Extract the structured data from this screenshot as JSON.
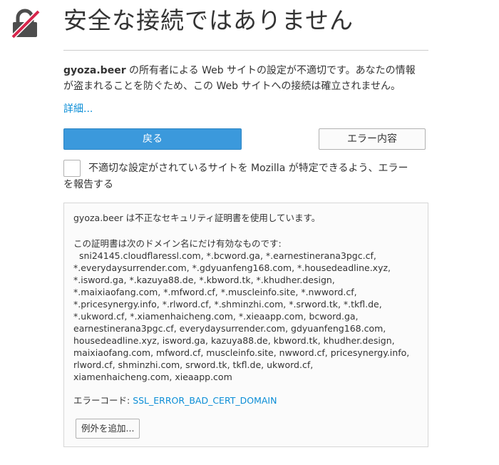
{
  "icon": {
    "name": "broken-lock-icon",
    "lock_color": "#4d4d4d",
    "strike_color": "#d7264c"
  },
  "header": {
    "title": "安全な接続ではありません"
  },
  "description": {
    "domain": "gyoza.beer",
    "line1_rest": " の所有者による Web サイトの設定が不適切です。あなたの情報",
    "line2": "が盗まれることを防ぐため、この Web サイトへの接続は確立されません。"
  },
  "details_link": "詳細...",
  "buttons": {
    "back": "戻る",
    "advanced": "エラー内容"
  },
  "report": {
    "line1": "不適切な設定がされているサイトを Mozilla が特定できるよう、エラー",
    "line2": "を報告する"
  },
  "panel": {
    "intro": "gyoza.beer は不正なセキュリティ証明書を使用しています。",
    "valid_heading": "この証明書は次のドメイン名にだけ有効なものです:",
    "domain_lines": [
      "  sni24145.cloudflaressl.com, *.bcword.ga, *.earnestinerana3pgc.cf,",
      "*.everydaysurrender.com, *.gdyuanfeng168.com, *.housedeadline.xyz,",
      "*.isword.ga, *.kazuya88.de, *.kbword.tk, *.khudher.design,",
      "*.maixiaofang.com, *.mfword.cf, *.muscleinfo.site, *.nwword.cf,",
      "*.pricesynergy.info, *.rlword.cf, *.shminzhi.com, *.srword.tk, *.tkfl.de,",
      "*.ukword.cf, *.xiamenhaicheng.com, *.xieaapp.com, bcword.ga,",
      "earnestinerana3pgc.cf, everydaysurrender.com, gdyuanfeng168.com,",
      "housedeadline.xyz, isword.ga, kazuya88.de, kbword.tk, khudher.design,",
      "maixiaofang.com, mfword.cf, muscleinfo.site, nwword.cf, pricesynergy.info,",
      "rlword.cf, shminzhi.com, srword.tk, tkfl.de, ukword.cf,",
      "xiamenhaicheng.com, xieaapp.com"
    ],
    "error_code_label": "エラーコード: ",
    "error_code": "SSL_ERROR_BAD_CERT_DOMAIN",
    "exception_button": "例外を追加..."
  },
  "colors": {
    "accent": "#3b99dc",
    "link": "#0a8dd6",
    "text": "#333333"
  }
}
